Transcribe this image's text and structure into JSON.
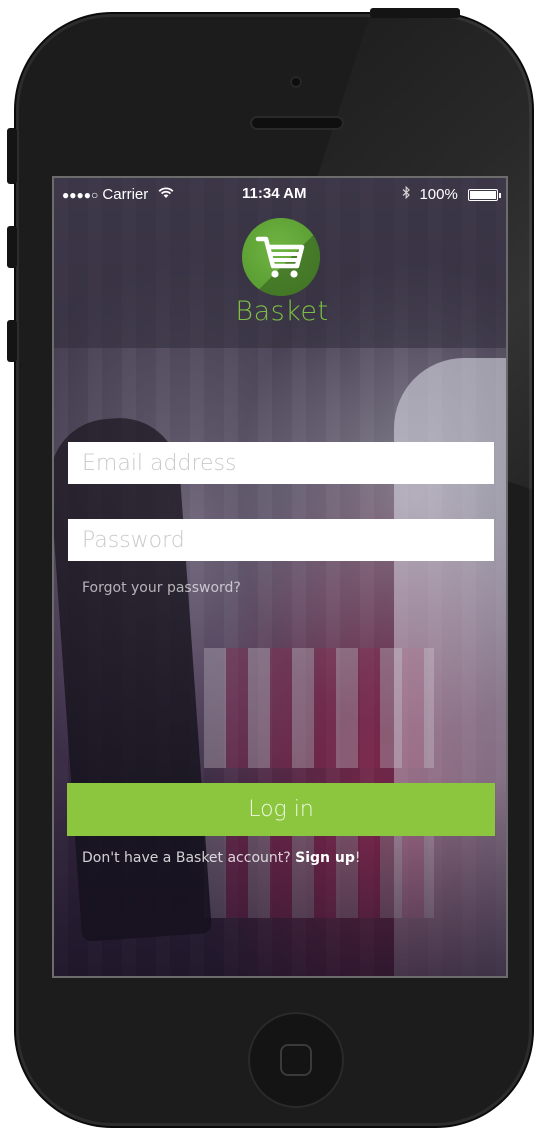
{
  "status_bar": {
    "signal": "●●●●○",
    "carrier": "Carrier",
    "time": "11:34 AM",
    "battery": "100%"
  },
  "app": {
    "name": "Basket",
    "accent_color": "#8cc63f"
  },
  "login": {
    "email_placeholder": "Email address",
    "email_value": "",
    "password_placeholder": "Password",
    "password_value": "",
    "forgot_label": "Forgot your password?",
    "login_label": "Log in",
    "signup_prompt": "Don't have a Basket account? ",
    "signup_link": "Sign up",
    "signup_suffix": "!"
  },
  "icons": {
    "logo": "shopping-cart-icon",
    "wifi": "wifi-icon",
    "bluetooth": "bluetooth-icon",
    "battery": "battery-icon"
  }
}
